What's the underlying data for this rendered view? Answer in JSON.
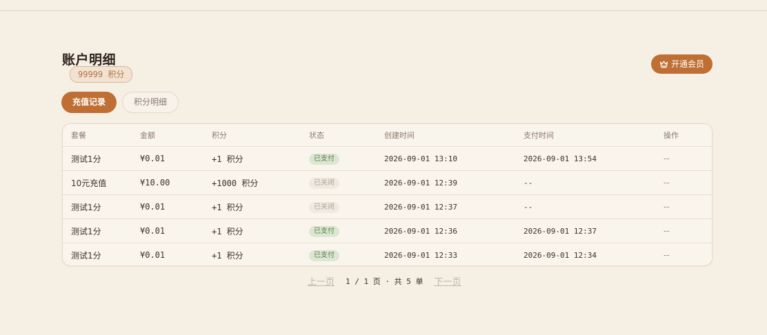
{
  "header": {
    "title": "账户明细",
    "points": "99999 积分",
    "vip_label": "开通会员"
  },
  "tabs": [
    {
      "label": "充值记录",
      "active": true
    },
    {
      "label": "积分明细",
      "active": false
    }
  ],
  "table": {
    "columns": [
      "套餐",
      "金额",
      "积分",
      "状态",
      "创建时间",
      "支付时间",
      "操作"
    ],
    "rows": [
      {
        "plan": "测试1分",
        "amount": "¥0.01",
        "points": "+1 积分",
        "status": "已支付",
        "status_type": "paid",
        "created": "2026-09-01 13:10",
        "paid": "2026-09-01 13:54",
        "action": "--"
      },
      {
        "plan": "10元充值",
        "amount": "¥10.00",
        "points": "+1000 积分",
        "status": "已关闭",
        "status_type": "closed",
        "created": "2026-09-01 12:39",
        "paid": "--",
        "action": "--"
      },
      {
        "plan": "测试1分",
        "amount": "¥0.01",
        "points": "+1 积分",
        "status": "已关闭",
        "status_type": "closed",
        "created": "2026-09-01 12:37",
        "paid": "--",
        "action": "--"
      },
      {
        "plan": "测试1分",
        "amount": "¥0.01",
        "points": "+1 积分",
        "status": "已支付",
        "status_type": "paid",
        "created": "2026-09-01 12:36",
        "paid": "2026-09-01 12:37",
        "action": "--"
      },
      {
        "plan": "测试1分",
        "amount": "¥0.01",
        "points": "+1 积分",
        "status": "已支付",
        "status_type": "paid",
        "created": "2026-09-01 12:33",
        "paid": "2026-09-01 12:34",
        "action": "--"
      }
    ]
  },
  "pager": {
    "prev_label": "上一页",
    "info": "1 / 1 页 · 共 5 单",
    "next_label": "下一页"
  },
  "icons": {
    "vip": "crown-icon"
  },
  "colors": {
    "accent": "#bf6f34",
    "background": "#f6efe4",
    "paid_bg": "#dce7d2",
    "closed_bg": "#efe9e0"
  }
}
